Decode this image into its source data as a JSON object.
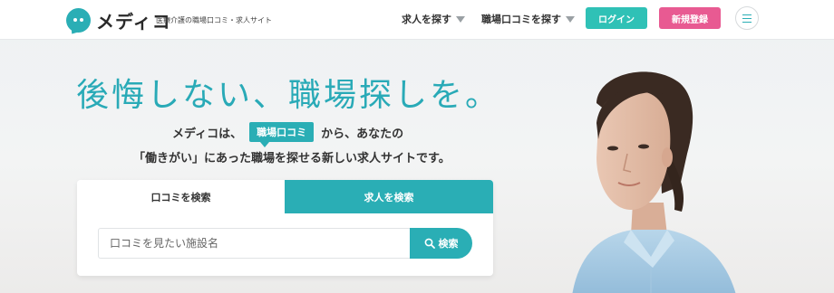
{
  "header": {
    "logo_text": "メディコ",
    "tagline": "医療介護の職場口コミ・求人サイト",
    "nav": [
      {
        "label": "求人を探す",
        "icon": "triangle-down-icon"
      },
      {
        "label": "職場口コミを探す",
        "icon": "triangle-down-icon"
      }
    ],
    "login_label": "ログイン",
    "register_label": "新規登録",
    "menu_icon": "hamburger-icon"
  },
  "hero": {
    "headline": "後悔しない、職場探しを。",
    "lead_prefix": "メディコは、",
    "lead_chip": "職場口コミ",
    "lead_suffix": "から、あなたの",
    "lead_line2": "「働きがい」にあった職場を探せる新しい求人サイトです。"
  },
  "search": {
    "tabs": [
      {
        "label": "口コミを検索",
        "active": false
      },
      {
        "label": "求人を検索",
        "active": true
      }
    ],
    "input_value": "",
    "placeholder": "口コミを見たい施設名",
    "button_label": "検索",
    "button_icon": "search-icon"
  },
  "colors": {
    "brand_teal": "#2aaeb5",
    "login_green": "#2fc1b6",
    "register_pink": "#e85a92"
  }
}
